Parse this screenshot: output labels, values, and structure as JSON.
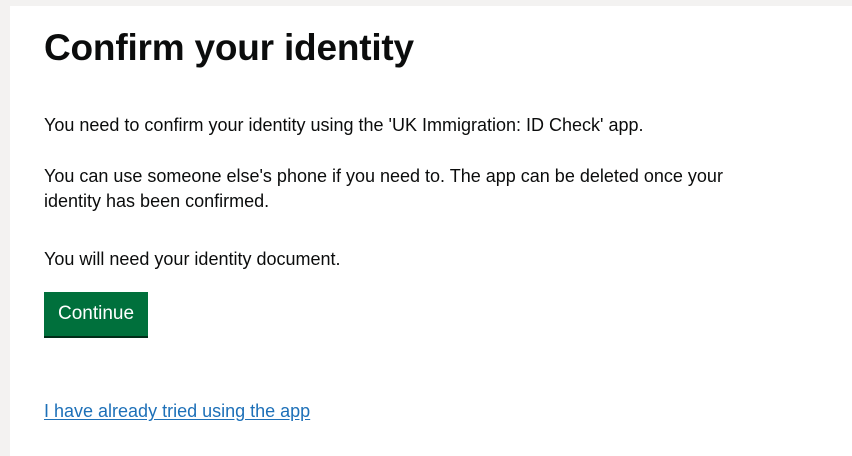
{
  "page": {
    "title": "Confirm your identity",
    "paragraphs": [
      "You need to confirm your identity using the 'UK Immigration: ID Check' app.",
      "You can use someone else's phone if you need to. The app can be deleted once your identity has been confirmed.",
      "You will need your identity document."
    ],
    "continue_label": "Continue",
    "already_tried_link": "I have already tried using the app"
  },
  "colors": {
    "button_green": "#00703c",
    "link_blue": "#1d70b8",
    "text": "#0b0c0c",
    "background": "#f3f2f1"
  }
}
